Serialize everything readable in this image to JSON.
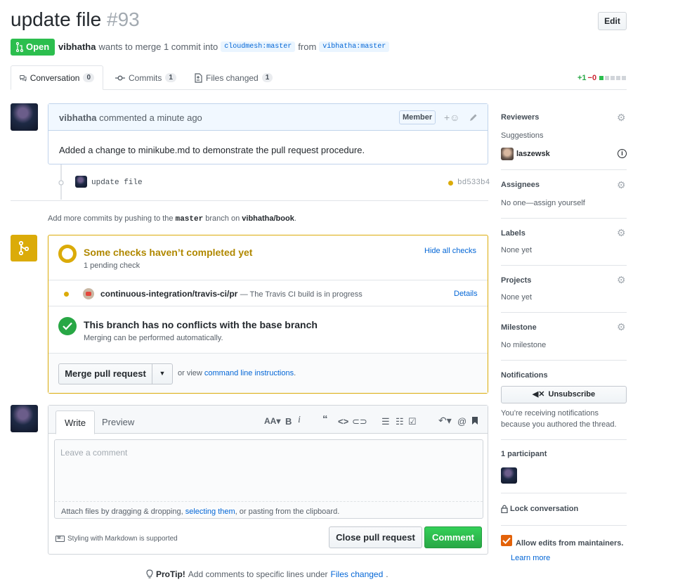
{
  "header": {
    "title": "update file",
    "number": "#93",
    "edit_label": "Edit",
    "state_label": "Open",
    "author": "vibhatha",
    "merge_text": "wants to merge 1 commit into",
    "base_ref": "cloudmesh:master",
    "from_text": "from",
    "head_ref": "vibhatha:master"
  },
  "tabs": [
    {
      "label": "Conversation",
      "count": "0"
    },
    {
      "label": "Commits",
      "count": "1"
    },
    {
      "label": "Files changed",
      "count": "1"
    }
  ],
  "diffstat": {
    "additions": "+1",
    "deletions": "−0"
  },
  "comment": {
    "author": "vibhatha",
    "action": "commented a minute ago",
    "badge": "Member",
    "body": "Added a change to minikube.md to demonstrate the pull request procedure."
  },
  "commit": {
    "message": "update file",
    "sha": "bd533b4"
  },
  "push_hint": {
    "prefix": "Add more commits by pushing to the",
    "branch": "master",
    "middle": "branch on",
    "repo": "vibhatha/book",
    "suffix": "."
  },
  "checks": {
    "title": "Some checks haven’t completed yet",
    "subtitle": "1 pending check",
    "hide_label": "Hide all checks",
    "check_name": "continuous-integration/travis-ci/pr",
    "check_desc": "— The Travis CI build is in progress",
    "details_label": "Details",
    "conflict_title": "This branch has no conflicts with the base branch",
    "conflict_sub": "Merging can be performed automatically.",
    "merge_button": "Merge pull request",
    "or_view": "or view",
    "cli_link": "command line instructions",
    "cli_suffix": "."
  },
  "composer": {
    "write_tab": "Write",
    "preview_tab": "Preview",
    "placeholder": "Leave a comment",
    "attach_prefix": "Attach files by dragging & dropping,",
    "attach_link": "selecting them",
    "attach_suffix": ", or pasting from the clipboard.",
    "markdown_note": "Styling with Markdown is supported",
    "close_button": "Close pull request",
    "comment_button": "Comment"
  },
  "protip": {
    "label": "ProTip!",
    "text": "Add comments to specific lines under",
    "link": "Files changed",
    "suffix": "."
  },
  "sidebar": {
    "reviewers": {
      "title": "Reviewers",
      "suggestions": "Suggestions",
      "user": "laszewsk"
    },
    "assignees": {
      "title": "Assignees",
      "value": "No one—assign yourself"
    },
    "labels": {
      "title": "Labels",
      "value": "None yet"
    },
    "projects": {
      "title": "Projects",
      "value": "None yet"
    },
    "milestone": {
      "title": "Milestone",
      "value": "No milestone"
    },
    "notifications": {
      "title": "Notifications",
      "button": "Unsubscribe",
      "reason": "You’re receiving notifications because you authored the thread."
    },
    "participants": {
      "title": "1 participant"
    },
    "lock": "Lock conversation",
    "allow_edits": "Allow edits from maintainers.",
    "learn_more": "Learn more"
  },
  "colors": {
    "open_green": "#2cbe4e",
    "pending_yellow": "#dbab09",
    "pending_text": "#b08800",
    "success_green": "#28a745",
    "link_blue": "#0366d6",
    "checkbox_orange": "#e36209"
  }
}
